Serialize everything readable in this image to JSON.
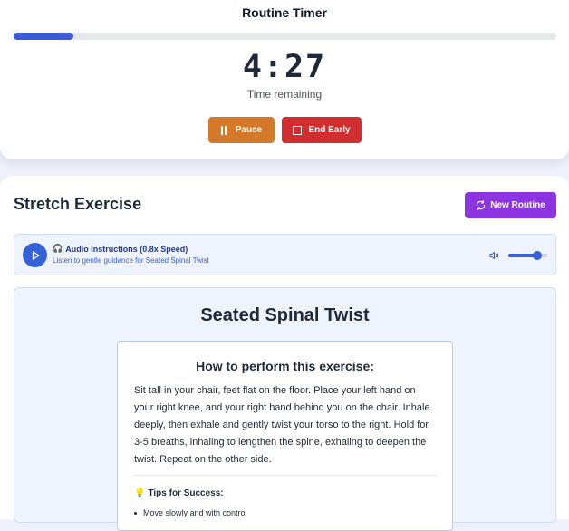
{
  "timer": {
    "title": "Routine Timer",
    "progress": 0.11,
    "time": "4:27",
    "time_label": "Time remaining",
    "pause_label": "Pause",
    "end_label": "End Early"
  },
  "exercise_section": {
    "title": "Stretch Exercise",
    "new_routine_label": "New Routine"
  },
  "audio": {
    "emoji": "🎧",
    "title": "Audio Instructions (0.8x Speed)",
    "subtitle": "Listen to gentle guidance for Seated Spinal Twist",
    "volume": 0.75
  },
  "exercise": {
    "name": "Seated Spinal Twist",
    "how_heading": "How to perform this exercise:",
    "instructions": "Sit tall in your chair, feet flat on the floor. Place your left hand on your right knee, and your right hand behind you on the chair. Inhale deeply, then exhale and gently twist your torso to the right. Hold for 3-5 breaths, inhaling to lengthen the spine, exhaling to deepen the twist. Repeat on the other side.",
    "tips_emoji": "💡",
    "tips_heading": "Tips for Success:",
    "tips": [
      "Move slowly and with control"
    ]
  },
  "colors": {
    "progress": "#3b5bdb",
    "pause": "#d4792a",
    "end": "#d12f2f",
    "new_routine": "#8b34e0",
    "audio_accent": "#3461d8"
  },
  "icons": {
    "pause": "pause-icon",
    "end": "stop-icon",
    "new_routine": "refresh-icon",
    "play": "play-icon",
    "audio": "headphones-icon",
    "volume": "volume-icon",
    "tips": "lightbulb-icon"
  }
}
